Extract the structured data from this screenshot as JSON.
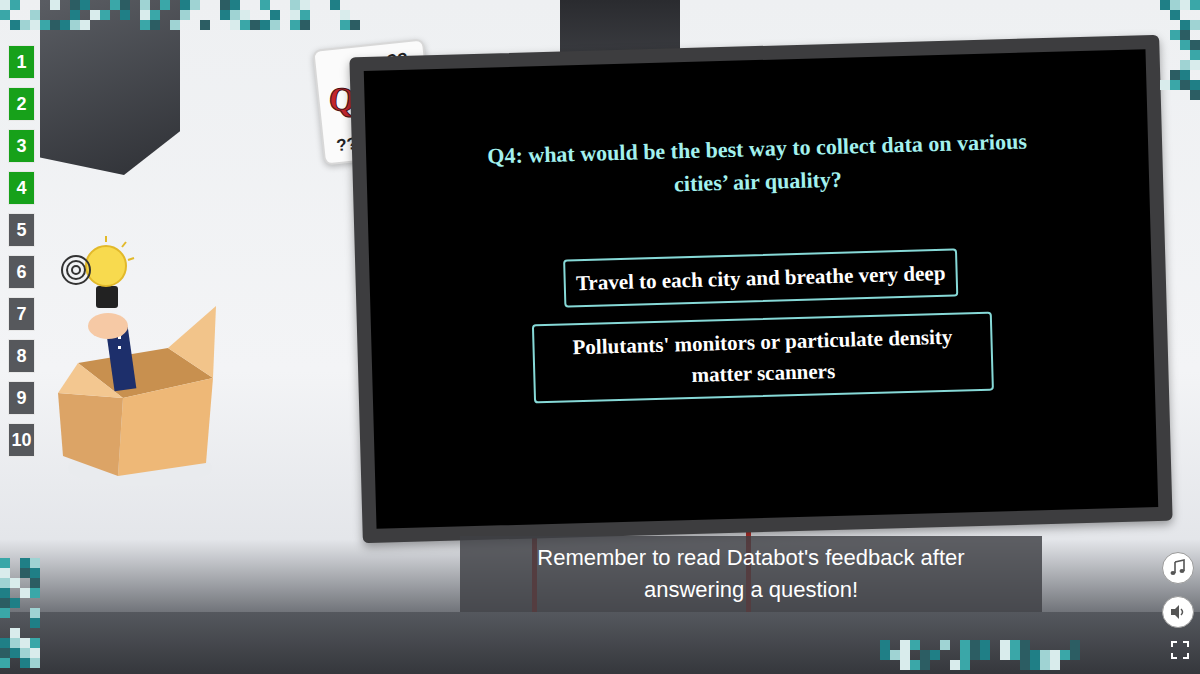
{
  "progress": [
    {
      "label": "1",
      "completed": true
    },
    {
      "label": "2",
      "completed": true
    },
    {
      "label": "3",
      "completed": true
    },
    {
      "label": "4",
      "completed": true
    },
    {
      "label": "5",
      "completed": false
    },
    {
      "label": "6",
      "completed": false
    },
    {
      "label": "7",
      "completed": false
    },
    {
      "label": "8",
      "completed": false
    },
    {
      "label": "9",
      "completed": false
    },
    {
      "label": "10",
      "completed": false
    }
  ],
  "quiz_sign": {
    "word": "QUIZ",
    "marks": [
      "??",
      "??"
    ]
  },
  "question": {
    "text": "Q4: what would be the best way to collect data on various cities’ air quality?"
  },
  "answers": [
    {
      "text": "Travel to each city and breathe very deep",
      "selected": false
    },
    {
      "text": "Pollutants' monitors or particulate density matter scanners",
      "selected": false
    }
  ],
  "caption": {
    "text": "Remember to read Databot's feedback after answering a question!"
  }
}
